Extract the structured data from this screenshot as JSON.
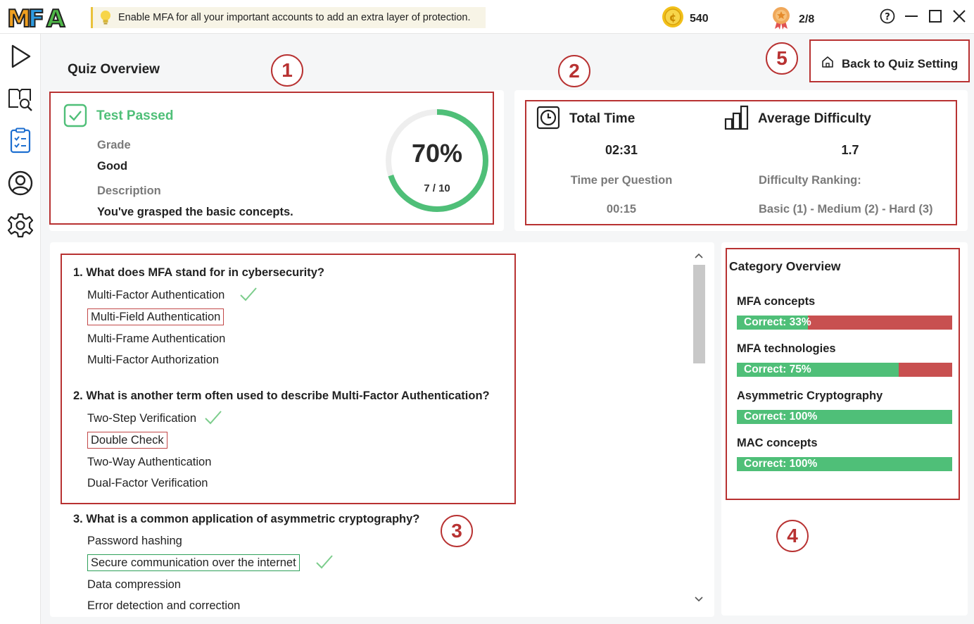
{
  "app": {
    "logo_text": "MFA"
  },
  "tip": {
    "icon": "lightbulb-icon",
    "text": "Enable MFA for all your important accounts to add an extra layer of protection."
  },
  "coins": {
    "icon": "coin-icon",
    "value": "540"
  },
  "badges": {
    "icon": "medal-icon",
    "value": "2/8"
  },
  "window_controls": [
    "help-icon",
    "minimize-icon",
    "maximize-icon",
    "close-icon"
  ],
  "sidebar": {
    "items": [
      "play-icon",
      "book-search-icon",
      "checklist-icon",
      "profile-icon",
      "settings-icon"
    ],
    "active_index": 2
  },
  "page": {
    "title": "Quiz Overview",
    "back_button": "Back to Quiz Setting"
  },
  "annotations": [
    "1",
    "2",
    "3",
    "4",
    "5"
  ],
  "result": {
    "status": "Test Passed",
    "grade_label": "Grade",
    "grade_value": "Good",
    "description_label": "Description",
    "description_value": "You've grasped the basic concepts.",
    "score_percent": "70%",
    "score_fraction": "7 / 10",
    "score_ratio": 0.7
  },
  "stats": {
    "total_time_label": "Total Time",
    "total_time_value": "02:31",
    "time_per_question_label": "Time per Question",
    "time_per_question_value": "00:15",
    "avg_difficulty_label": "Average Difficulty",
    "avg_difficulty_value": "1.7",
    "difficulty_ranking_label": "Difficulty Ranking:",
    "difficulty_ranking_value": "Basic (1) - Medium (2) - Hard (3)"
  },
  "questions": [
    {
      "title": "1. What does MFA stand for in cybersecurity?",
      "options": [
        "Multi-Factor Authentication",
        "Multi-Field Authentication",
        "Multi-Frame Authentication",
        "Multi-Factor Authorization"
      ]
    },
    {
      "title": "2. What is another term often used to describe Multi-Factor Authentication?",
      "options": [
        "Two-Step Verification",
        "Double Check",
        "Two-Way Authentication",
        "Dual-Factor Verification"
      ]
    },
    {
      "title": "3. What is a common application of asymmetric cryptography?",
      "options": [
        "Password hashing",
        "Secure communication over the internet",
        "Data compression",
        "Error detection and correction"
      ]
    }
  ],
  "category": {
    "title": "Category Overview",
    "items": [
      {
        "name": "MFA concepts",
        "label": "Correct: 33%",
        "ratio": 0.33
      },
      {
        "name": "MFA technologies",
        "label": "Correct: 75%",
        "ratio": 0.75
      },
      {
        "name": "Asymmetric Cryptography",
        "label": "Correct: 100%",
        "ratio": 1.0
      },
      {
        "name": "MAC concepts",
        "label": "Correct: 100%",
        "ratio": 1.0
      }
    ]
  },
  "colors": {
    "correct": "#4fbf78",
    "wrong": "#c85050",
    "annotation": "#b83232",
    "accent_blue": "#1e6fd0"
  }
}
